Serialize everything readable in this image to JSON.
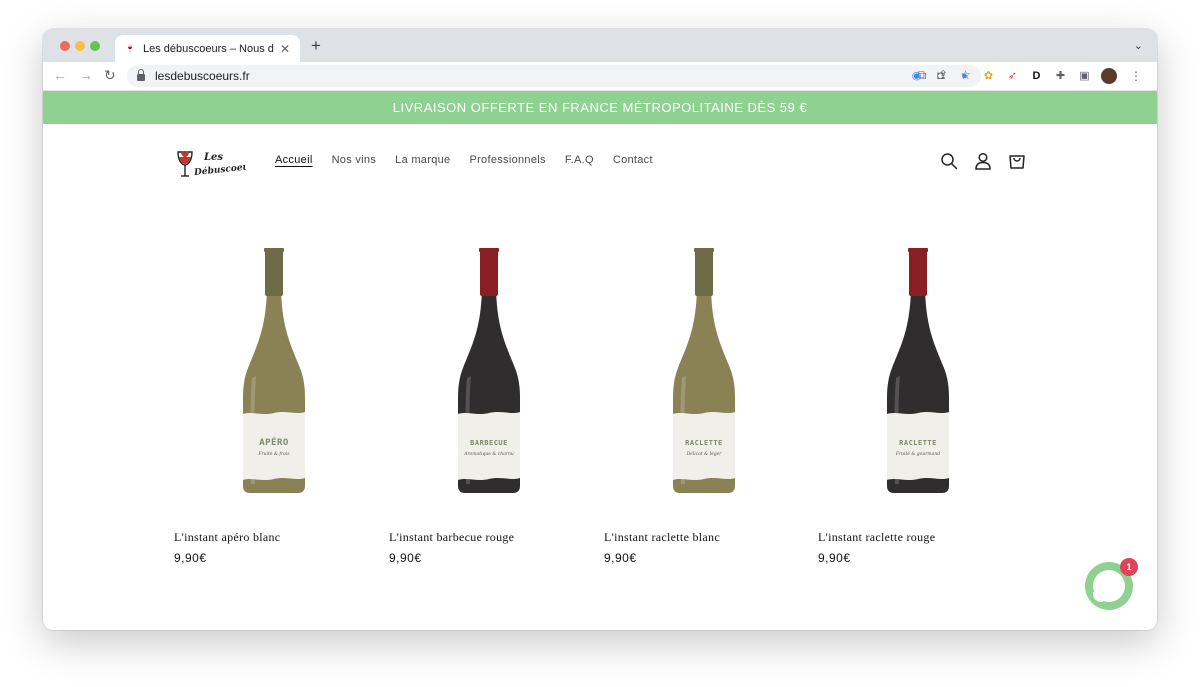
{
  "browser": {
    "tab_title": "Les débuscoeurs – Nous débuscons",
    "tab_close": "✕",
    "new_tab": "+",
    "tab_menu": "⌄",
    "url": "lesdebuscoeurs.fr"
  },
  "announcement": {
    "text": "LIVRAISON OFFERTE EN FRANCE MÉTROPOLITAINE DÈS 59 €"
  },
  "logo": {
    "line1": "Les",
    "line2": "Débuscoeurs"
  },
  "nav": {
    "items": [
      "Accueil",
      "Nos vins",
      "La marque",
      "Professionnels",
      "F.A.Q",
      "Contact"
    ],
    "active": "Accueil"
  },
  "header_icons": [
    "search-icon",
    "account-icon",
    "cart-icon"
  ],
  "products": [
    {
      "name": "L'instant apéro blanc",
      "price": "9,90€",
      "label_word": "APÉRO",
      "label_sub": "Fruité & frais",
      "bottle_color": "#8a8254",
      "cap_color": "#6e6b47"
    },
    {
      "name": "L'instant barbecue rouge",
      "price": "9,90€",
      "label_word": "BARBECUE",
      "label_sub": "Aromatique & charnu",
      "bottle_color": "#2f2d2e",
      "cap_color": "#8a1e25"
    },
    {
      "name": "L'instant raclette blanc",
      "price": "9,90€",
      "label_word": "RACLETTE",
      "label_sub": "Délicat & léger",
      "bottle_color": "#8a8254",
      "cap_color": "#6e6b47"
    },
    {
      "name": "L'instant raclette rouge",
      "price": "9,90€",
      "label_word": "RACLETTE",
      "label_sub": "Fruité & gourmand",
      "bottle_color": "#2f2d2e",
      "cap_color": "#8a1e25"
    }
  ],
  "chat": {
    "badge_count": "1"
  },
  "colors": {
    "accent_green": "#8ed191",
    "badge_red": "#e0435a"
  }
}
